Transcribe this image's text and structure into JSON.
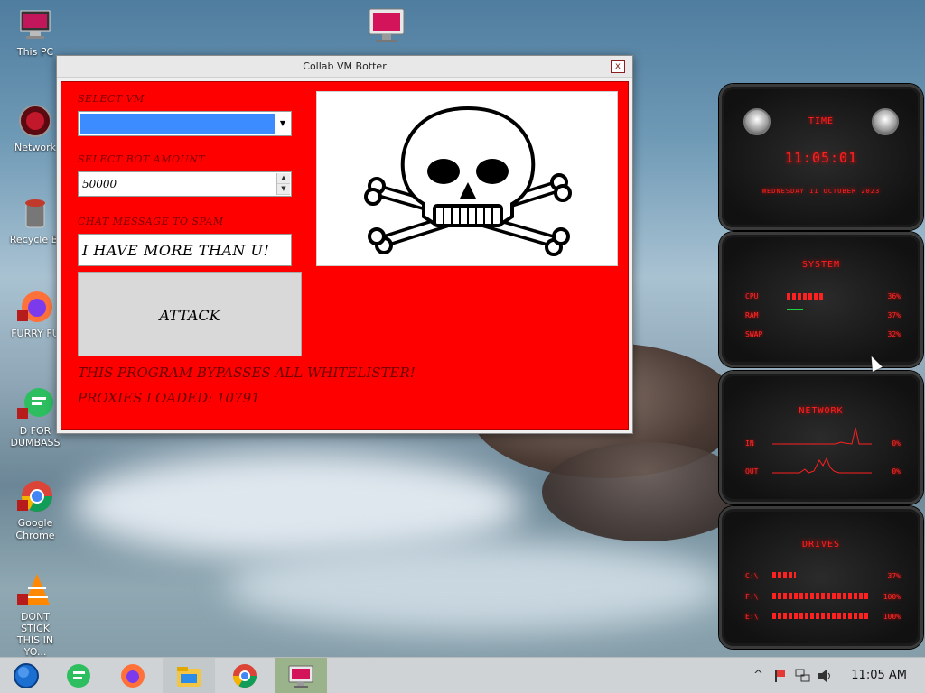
{
  "desktop": {
    "icons": [
      {
        "label": "This PC",
        "icon": "monitor-icon"
      },
      {
        "label": "Network",
        "icon": "network-icon"
      },
      {
        "label": "Recycle Bi",
        "icon": "recycle-bin-icon"
      },
      {
        "label": "FURRY FU",
        "icon": "firefox-icon"
      },
      {
        "label": "D FOR DUMBASS",
        "icon": "chat-app-icon"
      },
      {
        "label": "Google Chrome",
        "icon": "chrome-icon"
      },
      {
        "label": "DONT STICK THIS IN YO...",
        "icon": "vlc-icon"
      }
    ]
  },
  "window": {
    "title": "Collab VM Botter",
    "close_label": "x",
    "select_vm_label": "SELECT VM",
    "select_vm_value": "",
    "bot_amount_label": "SELECT BOT AMOUNT",
    "bot_amount_value": "50000",
    "chat_label": "CHAT MESSAGE TO SPAM",
    "chat_value": "I HAVE MORE THAN U!",
    "attack_label": "ATTACK",
    "bypass_text": "THIS PROGRAM BYPASSES ALL WHITELISTER!",
    "proxies_text": "PROXIES LOADED: 10791",
    "image_icon": "skull-and-crossbones-icon"
  },
  "gadgets": {
    "time": {
      "title": "TIME",
      "clock": "11:05:01",
      "date": "WEDNESDAY 11 OCTOBER 2023"
    },
    "system": {
      "title": "SYSTEM",
      "rows": [
        {
          "label": "CPU",
          "value": "36%"
        },
        {
          "label": "RAM",
          "value": "37%"
        },
        {
          "label": "SWAP",
          "value": "32%"
        }
      ]
    },
    "network": {
      "title": "NETWORK",
      "rows": [
        {
          "label": "IN",
          "value": "0%"
        },
        {
          "label": "OUT",
          "value": "0%"
        }
      ]
    },
    "drives": {
      "title": "DRIVES",
      "rows": [
        {
          "label": "C:\\",
          "value": "37%"
        },
        {
          "label": "F:\\",
          "value": "100%"
        },
        {
          "label": "E:\\",
          "value": "100%"
        }
      ]
    }
  },
  "taskbar": {
    "items": [
      "start-orb-icon",
      "chat-app-icon",
      "firefox-icon",
      "file-explorer-icon",
      "chrome-icon",
      "collab-vm-botter-icon"
    ],
    "active_item": "collab-vm-botter-icon",
    "tray_chevron": "^",
    "clock": "11:05 AM"
  },
  "colors": {
    "window_bg": "#ff0000",
    "gadget_red": "#ff2020"
  }
}
